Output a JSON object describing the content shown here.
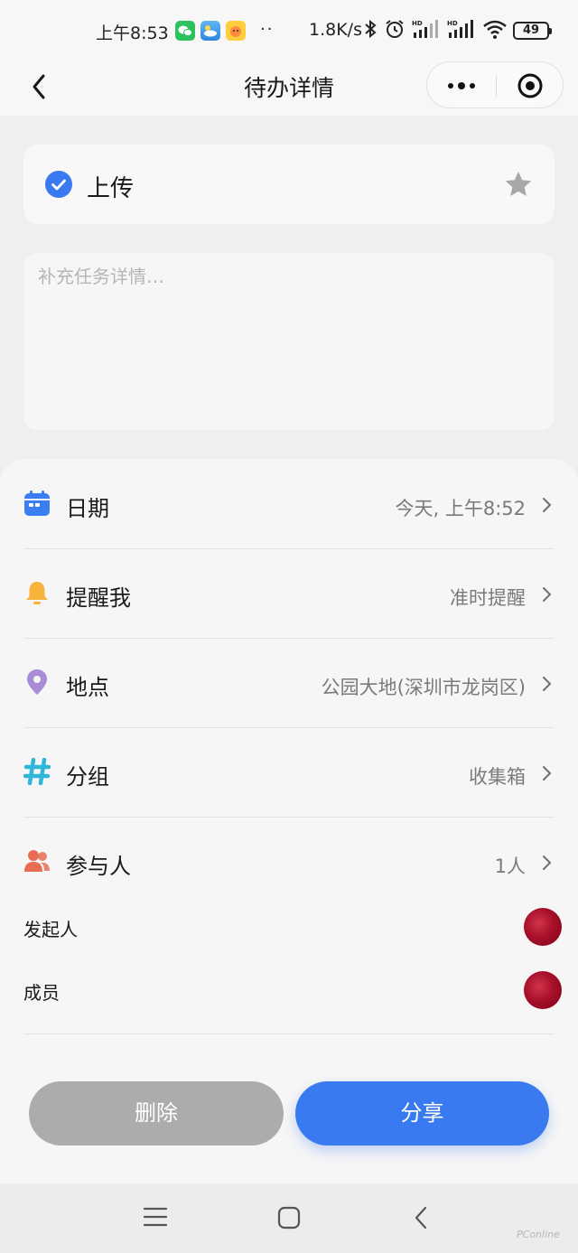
{
  "status_bar": {
    "time": "上午8:53",
    "dots": "··",
    "net_speed": "1.8K/s",
    "battery": "49"
  },
  "nav": {
    "title": "待办详情"
  },
  "task": {
    "title": "上传",
    "completed": true,
    "note_placeholder": "补充任务详情…"
  },
  "details": {
    "date": {
      "label": "日期",
      "value": "今天, 上午8:52"
    },
    "reminder": {
      "label": "提醒我",
      "value": "准时提醒"
    },
    "location": {
      "label": "地点",
      "value": "公园大地(深圳市龙岗区)"
    },
    "group": {
      "label": "分组",
      "value": "收集箱"
    },
    "participants": {
      "label": "参与人",
      "value": "1人"
    }
  },
  "people": {
    "initiator_label": "发起人",
    "member_label": "成员"
  },
  "actions": {
    "delete_label": "删除",
    "share_label": "分享"
  },
  "watermark": "PConline",
  "colors": {
    "accent": "#3a7af0",
    "date_icon": "#3b7ef2",
    "bell_icon": "#f7b33a",
    "location_icon": "#a98bd8",
    "group_icon": "#2fb6d8",
    "participants_icon": "#e96d55",
    "delete_button": "#acacac"
  }
}
